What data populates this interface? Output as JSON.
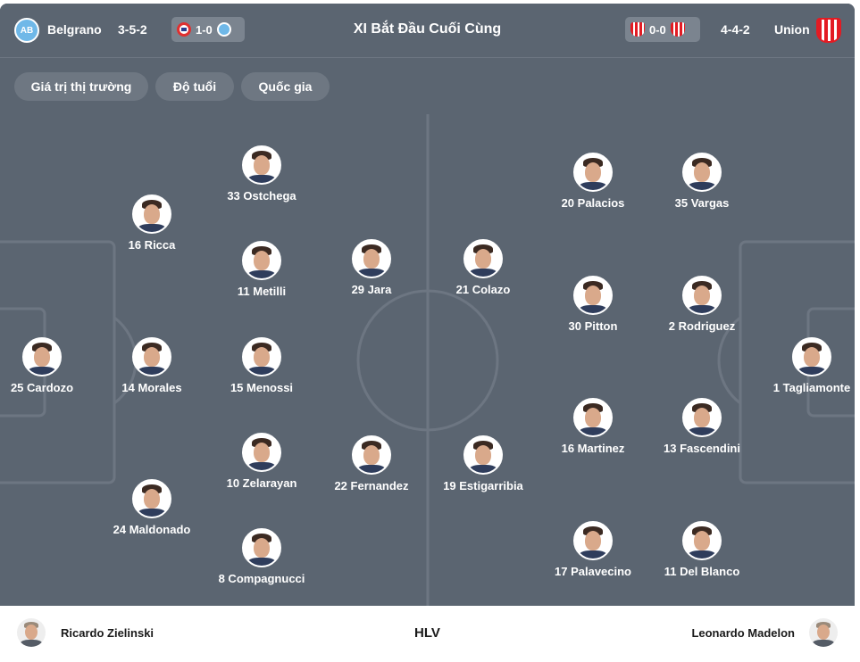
{
  "header": {
    "home_team": "Belgrano",
    "home_formation": "3-5-2",
    "home_last_score": "1-0",
    "title": "XI Bắt Đầu Cuối Cùng",
    "away_last_score": "0-0",
    "away_formation": "4-4-2",
    "away_team": "Union"
  },
  "filters": [
    "Giá trị thị trường",
    "Độ tuổi",
    "Quốc gia"
  ],
  "home_players": [
    {
      "label": "25 Cardozo"
    },
    {
      "label": "16 Ricca"
    },
    {
      "label": "14 Morales"
    },
    {
      "label": "24 Maldonado"
    },
    {
      "label": "33 Ostchega"
    },
    {
      "label": "11 Metilli"
    },
    {
      "label": "15 Menossi"
    },
    {
      "label": "10 Zelarayan"
    },
    {
      "label": "8 Compagnucci"
    },
    {
      "label": "29 Jara"
    },
    {
      "label": "22 Fernandez"
    }
  ],
  "away_players": [
    {
      "label": "21 Colazo"
    },
    {
      "label": "19 Estigarribia"
    },
    {
      "label": "20 Palacios"
    },
    {
      "label": "30 Pitton"
    },
    {
      "label": "16 Martinez"
    },
    {
      "label": "17 Palavecino"
    },
    {
      "label": "35 Vargas"
    },
    {
      "label": "2 Rodriguez"
    },
    {
      "label": "13 Fascendini"
    },
    {
      "label": "11 Del Blanco"
    },
    {
      "label": "1 Tagliamonte"
    }
  ],
  "coaches": {
    "home": "Ricardo Zielinski",
    "label": "HLV",
    "away": "Leonardo Madelon"
  },
  "colors": {
    "pitch": "#5b6571",
    "lines": "#6d7682",
    "text": "#ffffff"
  }
}
